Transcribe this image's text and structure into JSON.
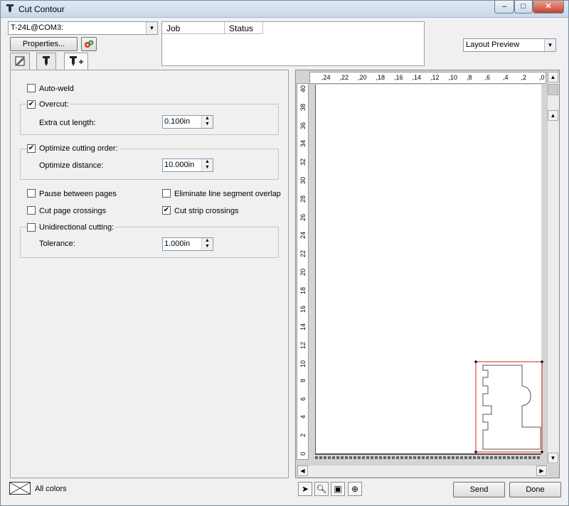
{
  "window": {
    "title": "Cut Contour",
    "minimize": "–",
    "maximize": "□",
    "close": "✕"
  },
  "device": {
    "selected": "T-24L@COM3:",
    "properties_label": "Properties..."
  },
  "job_table": {
    "columns": [
      "Job",
      "Status"
    ]
  },
  "preview_mode": {
    "selected": "Layout Preview"
  },
  "options": {
    "auto_weld": {
      "label": "Auto-weld",
      "checked": false
    },
    "overcut": {
      "label": "Overcut:",
      "checked": true,
      "extra_label": "Extra cut length:",
      "extra_value": "0.100in"
    },
    "optimize": {
      "label": "Optimize cutting order:",
      "checked": true,
      "distance_label": "Optimize distance:",
      "distance_value": "10.000in"
    },
    "pause_pages": {
      "label": "Pause between pages",
      "checked": false
    },
    "eliminate_overlap": {
      "label": "Eliminate line segment overlap",
      "checked": false
    },
    "cut_page_crossings": {
      "label": "Cut page crossings",
      "checked": false
    },
    "cut_strip_crossings": {
      "label": "Cut strip crossings",
      "checked": true
    },
    "unidirectional": {
      "label": "Unidirectional cutting:",
      "checked": false,
      "tolerance_label": "Tolerance:",
      "tolerance_value": "1.000in"
    }
  },
  "rulers": {
    "top": [
      ",24",
      ",22",
      ",20",
      ",18",
      ",16",
      ",14",
      ",12",
      ",10",
      ",8",
      ",6",
      ",4",
      ",2",
      ",0"
    ],
    "left": [
      "40",
      "38",
      "36",
      "34",
      "32",
      "30",
      "28",
      "26",
      "24",
      "22",
      "20",
      "18",
      "16",
      "14",
      "12",
      "10",
      "8",
      "6",
      "4",
      "2",
      "0"
    ]
  },
  "footer": {
    "colors_label": "All colors",
    "send_label": "Send",
    "done_label": "Done"
  },
  "icons": {
    "tab1": "paper-icon",
    "tab2": "blade-icon",
    "tab3": "blade-plus-icon",
    "tool1": "pointer-icon",
    "tool2": "zoom-icon",
    "tool3": "fit-page-icon",
    "tool4": "zoom-all-icon"
  },
  "colors": {
    "selection": "#d9261c",
    "accent": "#316ac5"
  }
}
